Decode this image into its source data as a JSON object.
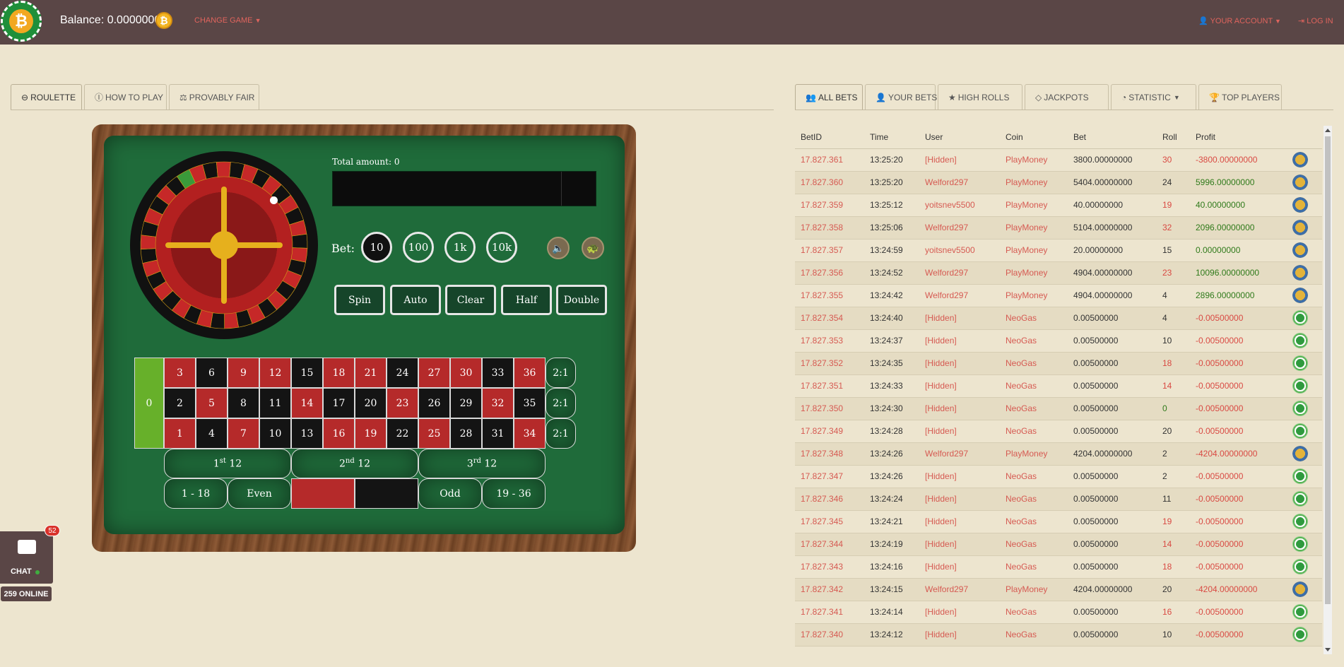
{
  "header": {
    "balance": "Balance: 0.00000000",
    "btc_symbol": "₿",
    "change_game": "CHANGE GAME",
    "your_account": "YOUR ACCOUNT",
    "login": "LOG IN"
  },
  "left_tabs": [
    {
      "label": "ROULETTE",
      "icon": "gamepad-icon"
    },
    {
      "label": "HOW TO PLAY",
      "icon": "info-icon"
    },
    {
      "label": "PROVABLY FAIR",
      "icon": "scale-icon"
    }
  ],
  "roulette": {
    "total_amount": "Total amount: 0",
    "bet_label": "Bet:",
    "chips": [
      "10",
      "100",
      "1k",
      "10k"
    ],
    "selected_chip": "10",
    "actions": [
      "Spin",
      "Auto",
      "Clear",
      "Half",
      "Double"
    ],
    "zero": "0",
    "rows": [
      [
        {
          "n": "3",
          "c": "red"
        },
        {
          "n": "6",
          "c": "black"
        },
        {
          "n": "9",
          "c": "red"
        },
        {
          "n": "12",
          "c": "red"
        },
        {
          "n": "15",
          "c": "black"
        },
        {
          "n": "18",
          "c": "red"
        },
        {
          "n": "21",
          "c": "red"
        },
        {
          "n": "24",
          "c": "black"
        },
        {
          "n": "27",
          "c": "red"
        },
        {
          "n": "30",
          "c": "red"
        },
        {
          "n": "33",
          "c": "black"
        },
        {
          "n": "36",
          "c": "red"
        }
      ],
      [
        {
          "n": "2",
          "c": "black"
        },
        {
          "n": "5",
          "c": "red"
        },
        {
          "n": "8",
          "c": "black"
        },
        {
          "n": "11",
          "c": "black"
        },
        {
          "n": "14",
          "c": "red"
        },
        {
          "n": "17",
          "c": "black"
        },
        {
          "n": "20",
          "c": "black"
        },
        {
          "n": "23",
          "c": "red"
        },
        {
          "n": "26",
          "c": "black"
        },
        {
          "n": "29",
          "c": "black"
        },
        {
          "n": "32",
          "c": "red"
        },
        {
          "n": "35",
          "c": "black"
        }
      ],
      [
        {
          "n": "1",
          "c": "red"
        },
        {
          "n": "4",
          "c": "black"
        },
        {
          "n": "7",
          "c": "red"
        },
        {
          "n": "10",
          "c": "black"
        },
        {
          "n": "13",
          "c": "black"
        },
        {
          "n": "16",
          "c": "red"
        },
        {
          "n": "19",
          "c": "red"
        },
        {
          "n": "22",
          "c": "black"
        },
        {
          "n": "25",
          "c": "red"
        },
        {
          "n": "28",
          "c": "black"
        },
        {
          "n": "31",
          "c": "black"
        },
        {
          "n": "34",
          "c": "red"
        }
      ]
    ],
    "column_bet": "2:1",
    "dozens": [
      {
        "pre": "1",
        "sup": "st",
        "post": " 12"
      },
      {
        "pre": "2",
        "sup": "nd",
        "post": " 12"
      },
      {
        "pre": "3",
        "sup": "rd",
        "post": " 12"
      }
    ],
    "outside": [
      "1 - 18",
      "Even",
      "",
      "",
      "Odd",
      "19 - 36"
    ],
    "colors": {
      "red": "#b52a2a",
      "black": "#141414",
      "green": "#67b02a",
      "felt": "#1f6b3a"
    }
  },
  "chat": {
    "label": "CHAT",
    "badge": "52",
    "online": "259 ONLINE"
  },
  "right_tabs": [
    {
      "label": "ALL BETS",
      "icon": "users-icon"
    },
    {
      "label": "YOUR BETS",
      "icon": "user-icon"
    },
    {
      "label": "HIGH ROLLS",
      "icon": "star-icon"
    },
    {
      "label": "JACKPOTS",
      "icon": "diamond-icon"
    },
    {
      "label": "STATISTIC",
      "icon": "pie-chart-icon"
    },
    {
      "label": "TOP PLAYERS",
      "icon": "trophy-icon"
    }
  ],
  "bets": {
    "columns": [
      "BetID",
      "Time",
      "User",
      "Coin",
      "Bet",
      "Roll",
      "Profit"
    ],
    "rows": [
      {
        "id": "17.827.361",
        "time": "13:25:20",
        "user": "[Hidden]",
        "coin": "PlayMoney",
        "bet": "3800.00000000",
        "roll": "30",
        "roll_red": true,
        "profit": "-3800.00000000",
        "neg": true,
        "icon": "pm"
      },
      {
        "id": "17.827.360",
        "time": "13:25:20",
        "user": "Welford297",
        "coin": "PlayMoney",
        "bet": "5404.00000000",
        "roll": "24",
        "roll_red": false,
        "profit": "5996.00000000",
        "neg": false,
        "icon": "pm"
      },
      {
        "id": "17.827.359",
        "time": "13:25:12",
        "user": "yoitsnev5500",
        "coin": "PlayMoney",
        "bet": "40.00000000",
        "roll": "19",
        "roll_red": true,
        "profit": "40.00000000",
        "neg": false,
        "icon": "pm"
      },
      {
        "id": "17.827.358",
        "time": "13:25:06",
        "user": "Welford297",
        "coin": "PlayMoney",
        "bet": "5104.00000000",
        "roll": "32",
        "roll_red": true,
        "profit": "2096.00000000",
        "neg": false,
        "icon": "pm"
      },
      {
        "id": "17.827.357",
        "time": "13:24:59",
        "user": "yoitsnev5500",
        "coin": "PlayMoney",
        "bet": "20.00000000",
        "roll": "15",
        "roll_red": false,
        "profit": "0.00000000",
        "neg": false,
        "icon": "pm"
      },
      {
        "id": "17.827.356",
        "time": "13:24:52",
        "user": "Welford297",
        "coin": "PlayMoney",
        "bet": "4904.00000000",
        "roll": "23",
        "roll_red": true,
        "profit": "10096.00000000",
        "neg": false,
        "icon": "pm"
      },
      {
        "id": "17.827.355",
        "time": "13:24:42",
        "user": "Welford297",
        "coin": "PlayMoney",
        "bet": "4904.00000000",
        "roll": "4",
        "roll_red": false,
        "profit": "2896.00000000",
        "neg": false,
        "icon": "pm"
      },
      {
        "id": "17.827.354",
        "time": "13:24:40",
        "user": "[Hidden]",
        "coin": "NeoGas",
        "bet": "0.00500000",
        "roll": "4",
        "roll_red": false,
        "profit": "-0.00500000",
        "neg": true,
        "icon": "ng"
      },
      {
        "id": "17.827.353",
        "time": "13:24:37",
        "user": "[Hidden]",
        "coin": "NeoGas",
        "bet": "0.00500000",
        "roll": "10",
        "roll_red": false,
        "profit": "-0.00500000",
        "neg": true,
        "icon": "ng"
      },
      {
        "id": "17.827.352",
        "time": "13:24:35",
        "user": "[Hidden]",
        "coin": "NeoGas",
        "bet": "0.00500000",
        "roll": "18",
        "roll_red": true,
        "profit": "-0.00500000",
        "neg": true,
        "icon": "ng"
      },
      {
        "id": "17.827.351",
        "time": "13:24:33",
        "user": "[Hidden]",
        "coin": "NeoGas",
        "bet": "0.00500000",
        "roll": "14",
        "roll_red": true,
        "profit": "-0.00500000",
        "neg": true,
        "icon": "ng"
      },
      {
        "id": "17.827.350",
        "time": "13:24:30",
        "user": "[Hidden]",
        "coin": "NeoGas",
        "bet": "0.00500000",
        "roll": "0",
        "roll_green": true,
        "profit": "-0.00500000",
        "neg": true,
        "icon": "ng"
      },
      {
        "id": "17.827.349",
        "time": "13:24:28",
        "user": "[Hidden]",
        "coin": "NeoGas",
        "bet": "0.00500000",
        "roll": "20",
        "roll_red": false,
        "profit": "-0.00500000",
        "neg": true,
        "icon": "ng"
      },
      {
        "id": "17.827.348",
        "time": "13:24:26",
        "user": "Welford297",
        "coin": "PlayMoney",
        "bet": "4204.00000000",
        "roll": "2",
        "roll_red": false,
        "profit": "-4204.00000000",
        "neg": true,
        "icon": "pm"
      },
      {
        "id": "17.827.347",
        "time": "13:24:26",
        "user": "[Hidden]",
        "coin": "NeoGas",
        "bet": "0.00500000",
        "roll": "2",
        "roll_red": false,
        "profit": "-0.00500000",
        "neg": true,
        "icon": "ng"
      },
      {
        "id": "17.827.346",
        "time": "13:24:24",
        "user": "[Hidden]",
        "coin": "NeoGas",
        "bet": "0.00500000",
        "roll": "11",
        "roll_red": false,
        "profit": "-0.00500000",
        "neg": true,
        "icon": "ng"
      },
      {
        "id": "17.827.345",
        "time": "13:24:21",
        "user": "[Hidden]",
        "coin": "NeoGas",
        "bet": "0.00500000",
        "roll": "19",
        "roll_red": true,
        "profit": "-0.00500000",
        "neg": true,
        "icon": "ng"
      },
      {
        "id": "17.827.344",
        "time": "13:24:19",
        "user": "[Hidden]",
        "coin": "NeoGas",
        "bet": "0.00500000",
        "roll": "14",
        "roll_red": true,
        "profit": "-0.00500000",
        "neg": true,
        "icon": "ng"
      },
      {
        "id": "17.827.343",
        "time": "13:24:16",
        "user": "[Hidden]",
        "coin": "NeoGas",
        "bet": "0.00500000",
        "roll": "18",
        "roll_red": true,
        "profit": "-0.00500000",
        "neg": true,
        "icon": "ng"
      },
      {
        "id": "17.827.342",
        "time": "13:24:15",
        "user": "Welford297",
        "coin": "PlayMoney",
        "bet": "4204.00000000",
        "roll": "20",
        "roll_red": false,
        "profit": "-4204.00000000",
        "neg": true,
        "icon": "pm"
      },
      {
        "id": "17.827.341",
        "time": "13:24:14",
        "user": "[Hidden]",
        "coin": "NeoGas",
        "bet": "0.00500000",
        "roll": "16",
        "roll_red": true,
        "profit": "-0.00500000",
        "neg": true,
        "icon": "ng"
      },
      {
        "id": "17.827.340",
        "time": "13:24:12",
        "user": "[Hidden]",
        "coin": "NeoGas",
        "bet": "0.00500000",
        "roll": "10",
        "roll_red": false,
        "profit": "-0.00500000",
        "neg": true,
        "icon": "ng"
      }
    ]
  }
}
